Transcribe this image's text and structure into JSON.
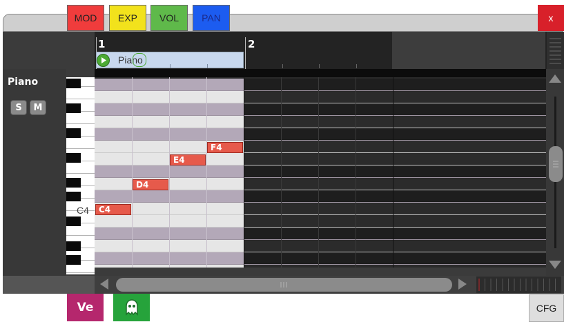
{
  "tabs": [
    {
      "label": "MOD",
      "color": "#f03c3c"
    },
    {
      "label": "EXP",
      "color": "#f2e21c"
    },
    {
      "label": "VOL",
      "color": "#5fb94a"
    },
    {
      "label": "PAN",
      "color": "#1c5cf0"
    }
  ],
  "close_label": "x",
  "close_color": "#d8202a",
  "ruler": {
    "bar1": "1",
    "bar2": "2"
  },
  "region": {
    "label": "Piano",
    "play_icon": "play-icon"
  },
  "track": {
    "name": "Piano",
    "solo_label": "S",
    "mute_label": "M"
  },
  "keyboard": {
    "c4_label": "C4"
  },
  "notes": [
    {
      "label": "C4"
    },
    {
      "label": "D4"
    },
    {
      "label": "E4"
    },
    {
      "label": "F4"
    }
  ],
  "bottom": {
    "ve_label": "Ve",
    "ghost_icon": "ghost-icon",
    "cfg_label": "CFG"
  },
  "colors": {
    "note": "#e65a4b",
    "region": "#c8d8ee",
    "grid_light_white": "#e6e6e6",
    "grid_light_black": "#b3a8b8"
  }
}
